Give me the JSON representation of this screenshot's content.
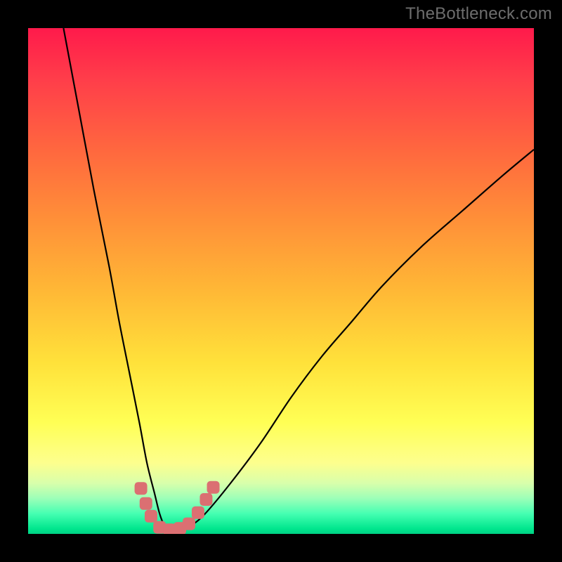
{
  "watermark": {
    "text": "TheBottleneck.com"
  },
  "colors": {
    "frame": "#000000",
    "gradient_top": "#ff1a4b",
    "gradient_bottom": "#00d084",
    "curve": "#000000",
    "marker": "#db6f72"
  },
  "chart_data": {
    "type": "line",
    "title": "",
    "xlabel": "",
    "ylabel": "",
    "xlim": [
      0,
      100
    ],
    "ylim": [
      0,
      100
    ],
    "grid": false,
    "legend": false,
    "series": [
      {
        "name": "bottleneck-curve",
        "x": [
          7,
          10,
          13,
          16,
          18,
          20,
          22,
          23.5,
          25,
          26,
          27,
          28,
          29.5,
          32,
          35,
          40,
          46,
          52,
          58,
          64,
          70,
          78,
          86,
          94,
          100
        ],
        "y": [
          100,
          84,
          68,
          53,
          42,
          32,
          22,
          14,
          8,
          4,
          1.5,
          0.5,
          0.5,
          1.5,
          4,
          10,
          18,
          27,
          35,
          42,
          49,
          57,
          64,
          71,
          76
        ]
      }
    ],
    "markers": [
      {
        "x": 22.3,
        "y": 9.0
      },
      {
        "x": 23.3,
        "y": 6.0
      },
      {
        "x": 24.3,
        "y": 3.5
      },
      {
        "x": 26.0,
        "y": 1.3
      },
      {
        "x": 28.0,
        "y": 0.8
      },
      {
        "x": 30.0,
        "y": 1.1
      },
      {
        "x": 31.8,
        "y": 2.0
      },
      {
        "x": 33.6,
        "y": 4.2
      },
      {
        "x": 35.2,
        "y": 6.8
      },
      {
        "x": 36.6,
        "y": 9.2
      }
    ]
  }
}
